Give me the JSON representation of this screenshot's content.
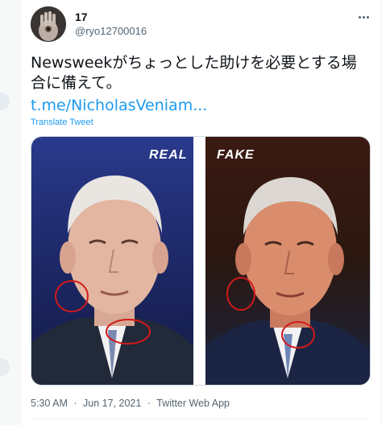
{
  "author": {
    "display_name": "17",
    "handle": "@ryo12700016"
  },
  "tweet": {
    "text": "Newsweekがちょっとした助けを必要とする場合に備えて。",
    "link": "t.me/NicholasVeniam...",
    "translate_label": "Translate Tweet"
  },
  "media": {
    "left_label": "REAL",
    "right_label": "FAKE"
  },
  "meta": {
    "time": "5:30 AM",
    "date": "Jun 17, 2021",
    "source": "Twitter Web App",
    "separator": "·"
  },
  "colors": {
    "link": "#1d9bf0",
    "secondary_text": "#536471",
    "annotation_circle": "#d21a1a"
  },
  "icons": {
    "more": "more-horizontal-icon"
  }
}
